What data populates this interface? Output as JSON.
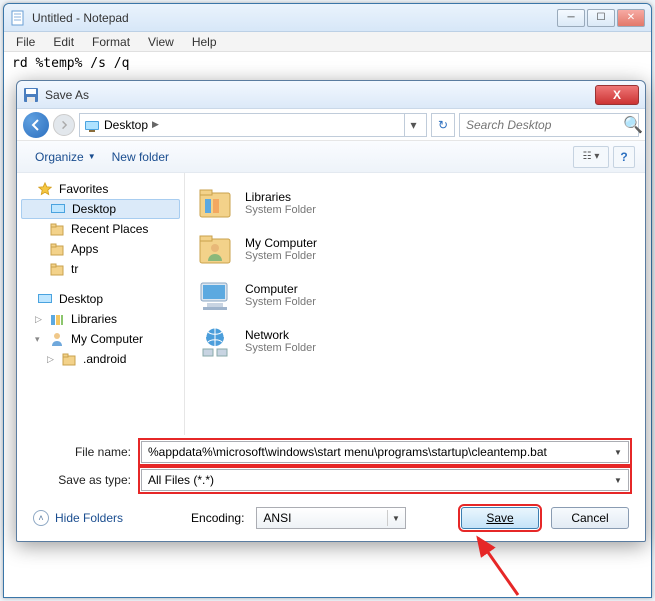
{
  "notepad": {
    "title": "Untitled - Notepad",
    "menu": {
      "file": "File",
      "edit": "Edit",
      "format": "Format",
      "view": "View",
      "help": "Help"
    },
    "body_text": "rd %temp% /s /q"
  },
  "saveas": {
    "title": "Save As",
    "close": "X",
    "address": {
      "location": "Desktop",
      "chevron": "▶"
    },
    "search": {
      "placeholder": "Search Desktop"
    },
    "toolbar": {
      "organize": "Organize",
      "newfolder": "New folder",
      "help": "?"
    },
    "sidebar": {
      "favorites": "Favorites",
      "fav_items": [
        {
          "label": "Desktop"
        },
        {
          "label": "Recent Places"
        },
        {
          "label": "Apps"
        },
        {
          "label": "tr"
        }
      ],
      "desktop": "Desktop",
      "desk_items": [
        {
          "label": "Libraries"
        },
        {
          "label": "My Computer"
        },
        {
          "label": ".android"
        }
      ]
    },
    "list": {
      "sub": "System Folder",
      "items": [
        {
          "name": "Libraries"
        },
        {
          "name": "My Computer"
        },
        {
          "name": "Computer"
        },
        {
          "name": "Network"
        }
      ]
    },
    "fields": {
      "filename_label": "File name:",
      "filename_value": "%appdata%\\microsoft\\windows\\start menu\\programs\\startup\\cleantemp.bat",
      "savetype_label": "Save as type:",
      "savetype_value": "All Files  (*.*)"
    },
    "bottom": {
      "hide": "Hide Folders",
      "encoding_label": "Encoding:",
      "encoding_value": "ANSI",
      "save": "Save",
      "cancel": "Cancel"
    }
  }
}
